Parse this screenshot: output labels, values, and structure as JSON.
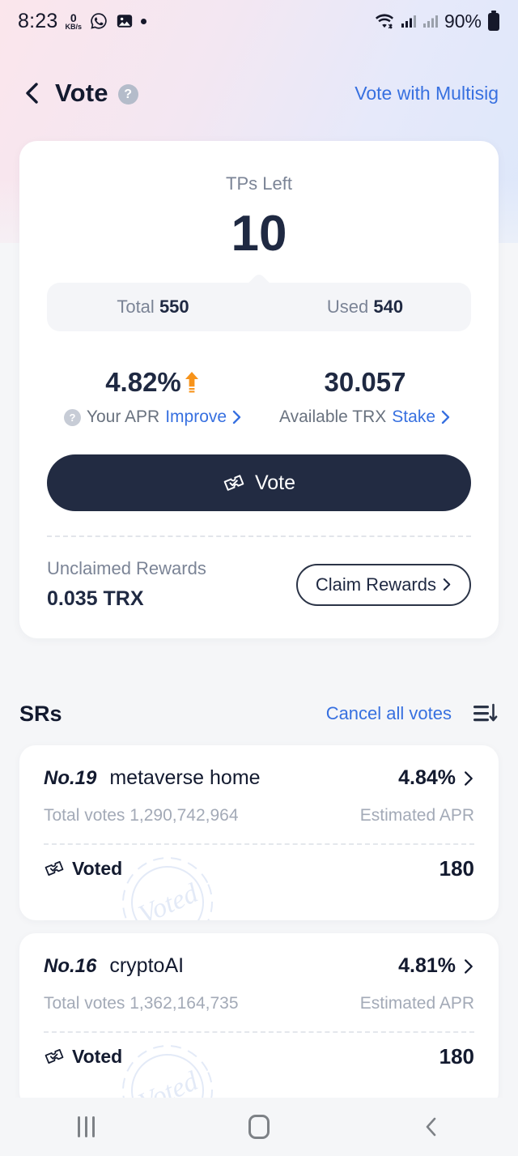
{
  "status_bar": {
    "time": "8:23",
    "net_rate_value": "0",
    "net_rate_unit": "KB/s",
    "icons": [
      "whatsapp-icon",
      "image-icon",
      "dot-icon"
    ],
    "wifi": "wifi-icon",
    "signal_1": "signal-icon",
    "signal_2": "signal-icon",
    "battery_percent": "90%",
    "battery": "battery-icon"
  },
  "header": {
    "back": "chevron-left-icon",
    "title": "Vote",
    "help": "?",
    "multisig_link": "Vote with Multisig"
  },
  "summary": {
    "tps_label": "TPs Left",
    "tps_value": "10",
    "total_label": "Total",
    "total_value": "550",
    "used_label": "Used",
    "used_value": "540",
    "apr_value": "4.82%",
    "apr_trend": "up-arrow-icon",
    "apr_help": "?",
    "apr_label": "Your APR",
    "apr_link": "Improve",
    "trx_value": "30.057",
    "trx_label": "Available TRX",
    "trx_link": "Stake",
    "vote_button": "Vote",
    "unclaimed_label": "Unclaimed Rewards",
    "unclaimed_value": "0.035 TRX",
    "claim_button": "Claim Rewards"
  },
  "srs_section": {
    "title": "SRs",
    "cancel_all": "Cancel all votes",
    "sort": "sort-icon",
    "items": [
      {
        "rank": "No.19",
        "name": "metaverse home",
        "apr": "4.84%",
        "total_votes": "Total votes 1,290,742,964",
        "apr_label": "Estimated APR",
        "voted_label": "Voted",
        "voted_count": "180",
        "stamp_text": "Voted"
      },
      {
        "rank": "No.16",
        "name": "cryptoAI",
        "apr": "4.81%",
        "total_votes": "Total votes 1,362,164,735",
        "apr_label": "Estimated APR",
        "voted_label": "Voted",
        "voted_count": "180",
        "stamp_text": "Voted"
      }
    ]
  },
  "nav_bar": {
    "recents": "recents-icon",
    "home": "home-icon",
    "back": "back-icon"
  },
  "colors": {
    "accent_blue": "#3770e0",
    "dark_navy": "#222b42",
    "muted_gray": "#7b8496",
    "orange": "#f7931a"
  }
}
